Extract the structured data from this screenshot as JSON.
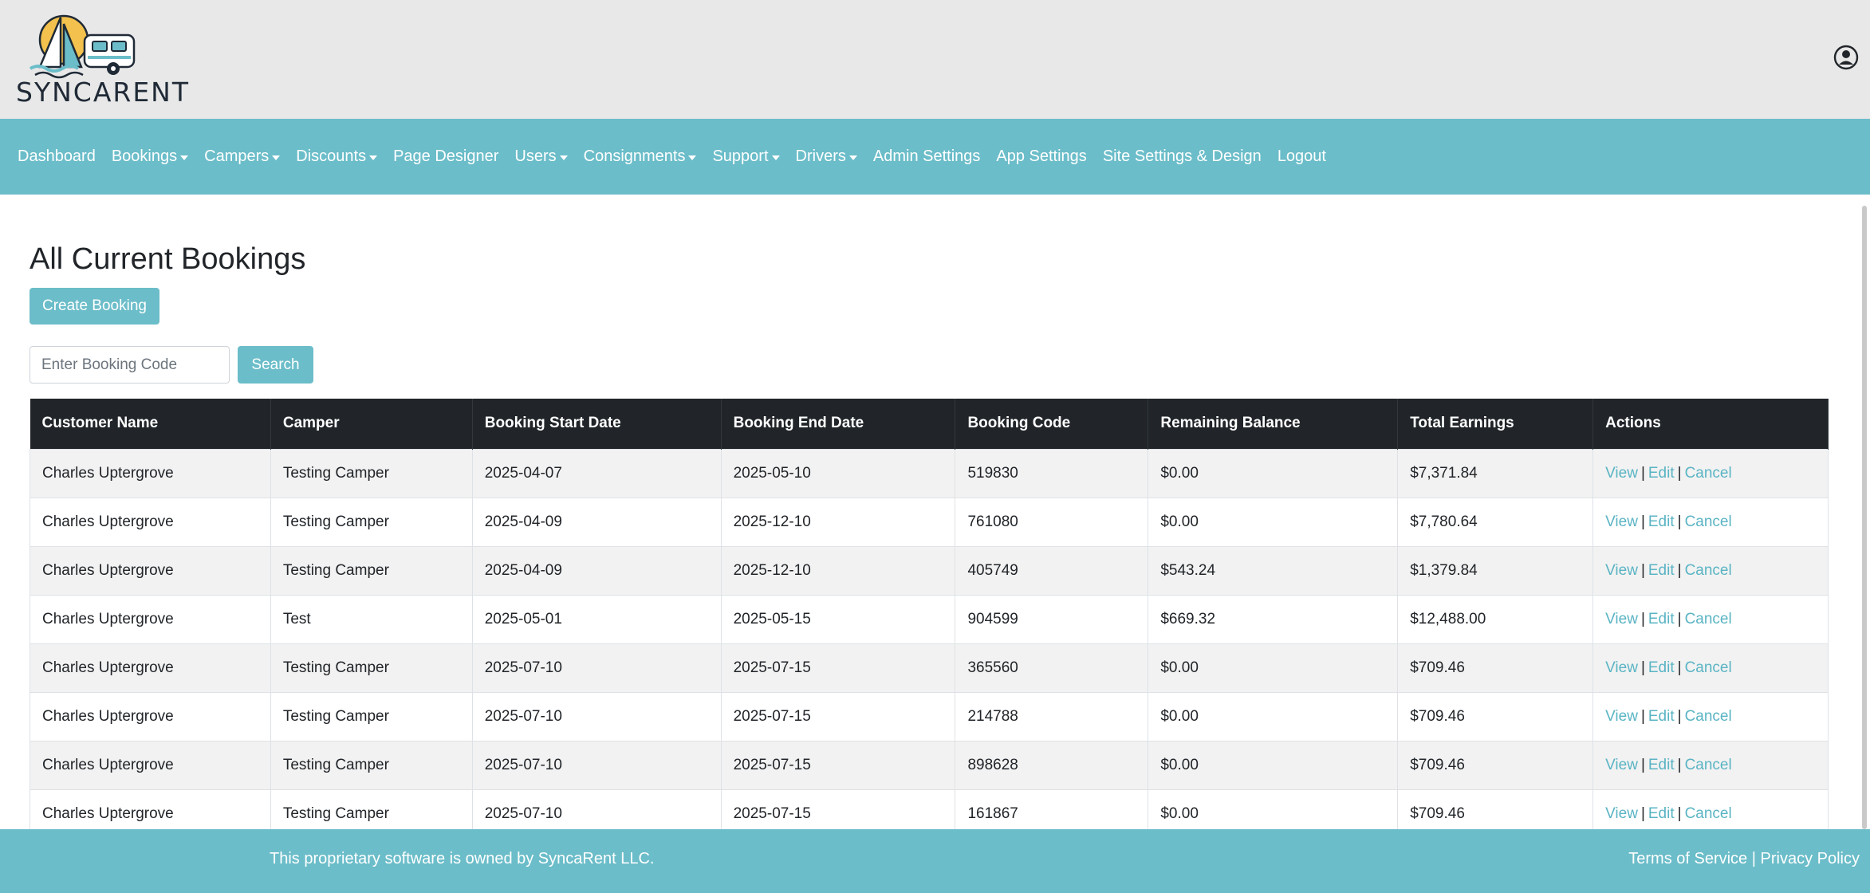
{
  "brand": {
    "name": "SYNCARENT"
  },
  "nav": {
    "items": [
      {
        "label": "Dashboard",
        "dropdown": false
      },
      {
        "label": "Bookings",
        "dropdown": true
      },
      {
        "label": "Campers",
        "dropdown": true
      },
      {
        "label": "Discounts",
        "dropdown": true
      },
      {
        "label": "Page Designer",
        "dropdown": false
      },
      {
        "label": "Users",
        "dropdown": true
      },
      {
        "label": "Consignments",
        "dropdown": true
      },
      {
        "label": "Support",
        "dropdown": true
      },
      {
        "label": "Drivers",
        "dropdown": true
      },
      {
        "label": "Admin Settings",
        "dropdown": false
      },
      {
        "label": "App Settings",
        "dropdown": false
      },
      {
        "label": "Site Settings & Design",
        "dropdown": false
      },
      {
        "label": "Logout",
        "dropdown": false
      }
    ]
  },
  "page": {
    "title": "All Current Bookings",
    "create_label": "Create Booking",
    "search_placeholder": "Enter Booking Code",
    "search_label": "Search"
  },
  "table": {
    "columns": [
      "Customer Name",
      "Camper",
      "Booking Start Date",
      "Booking End Date",
      "Booking Code",
      "Remaining Balance",
      "Total Earnings",
      "Actions"
    ],
    "actions": {
      "view": "View",
      "edit": "Edit",
      "cancel": "Cancel",
      "sep": "|"
    },
    "rows": [
      [
        "Charles Uptergrove",
        "Testing Camper",
        "2025-04-07",
        "2025-05-10",
        "519830",
        "$0.00",
        "$7,371.84"
      ],
      [
        "Charles Uptergrove",
        "Testing Camper",
        "2025-04-09",
        "2025-12-10",
        "761080",
        "$0.00",
        "$7,780.64"
      ],
      [
        "Charles Uptergrove",
        "Testing Camper",
        "2025-04-09",
        "2025-12-10",
        "405749",
        "$543.24",
        "$1,379.84"
      ],
      [
        "Charles Uptergrove",
        "Test",
        "2025-05-01",
        "2025-05-15",
        "904599",
        "$669.32",
        "$12,488.00"
      ],
      [
        "Charles Uptergrove",
        "Testing Camper",
        "2025-07-10",
        "2025-07-15",
        "365560",
        "$0.00",
        "$709.46"
      ],
      [
        "Charles Uptergrove",
        "Testing Camper",
        "2025-07-10",
        "2025-07-15",
        "214788",
        "$0.00",
        "$709.46"
      ],
      [
        "Charles Uptergrove",
        "Testing Camper",
        "2025-07-10",
        "2025-07-15",
        "898628",
        "$0.00",
        "$709.46"
      ],
      [
        "Charles Uptergrove",
        "Testing Camper",
        "2025-07-10",
        "2025-07-15",
        "161867",
        "$0.00",
        "$709.46"
      ]
    ]
  },
  "footer": {
    "left": "This proprietary software is owned by SyncaRent LLC.",
    "terms": "Terms of Service",
    "sep": "|",
    "privacy": "Privacy Policy"
  },
  "colors": {
    "accent": "#6bbdc9",
    "header_bg": "#e8e8e8",
    "table_head": "#212529",
    "link": "#5ab4c4"
  },
  "icons": {
    "user": "user-circle-icon",
    "logo": "sailboat-camper-logo-icon"
  }
}
